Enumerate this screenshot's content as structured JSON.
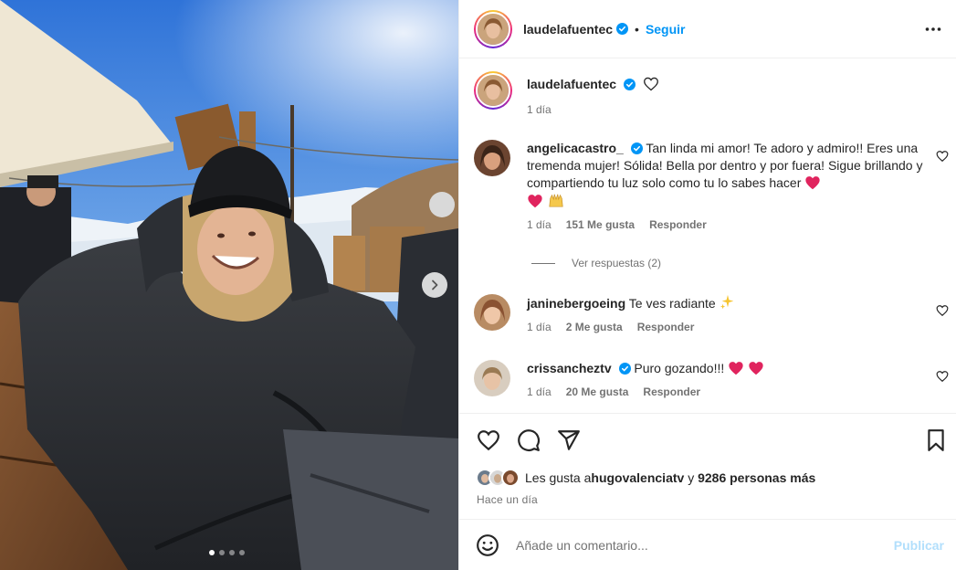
{
  "post": {
    "author": "laudelafuentec",
    "follow_label": "Seguir",
    "caption_time": "1 día",
    "carousel": {
      "slide_count": 4,
      "active_index": 0
    }
  },
  "icons": {
    "more": "more-horizontal-icon",
    "verified": "verified-badge-icon",
    "heart": "heart-outline-icon",
    "comment": "comment-icon",
    "share": "paper-plane-icon",
    "save": "bookmark-icon",
    "emoji": "smiley-icon",
    "next": "chevron-right-icon"
  },
  "comments": [
    {
      "username": "angelicacastro_",
      "verified": true,
      "text": "Tan linda mi amor! Te adoro y admiro!! Eres una tremenda mujer! Sólida! Bella por dentro y por fuera! Sigue brillando y compartiendo tu luz solo como tu lo sabes hacer",
      "time": "1 día",
      "likes": "151 Me gusta",
      "reply": "Responder",
      "view_replies": "Ver respuestas (2)"
    },
    {
      "username": "janinebergoeing",
      "verified": false,
      "text": "Te ves radiante",
      "time": "1 día",
      "likes": "2 Me gusta",
      "reply": "Responder"
    },
    {
      "username": "crissanchez tv",
      "display_username": "crissancheztv",
      "verified": true,
      "text": "Puro gozando!!!",
      "time": "1 día",
      "likes": "20 Me gusta",
      "reply": "Responder"
    }
  ],
  "likes": {
    "prefix": "Les gusta a ",
    "user": "hugovalenciatv",
    "connector": " y ",
    "others": "9286 personas más",
    "time_ago": "Hace un día"
  },
  "composer": {
    "placeholder": "Añade un comentario...",
    "publish_label": "Publicar"
  },
  "colors": {
    "accent": "#0095f6",
    "verified": "#0095f6",
    "heart_red": "#e0245e",
    "muted_text": "#737373"
  }
}
